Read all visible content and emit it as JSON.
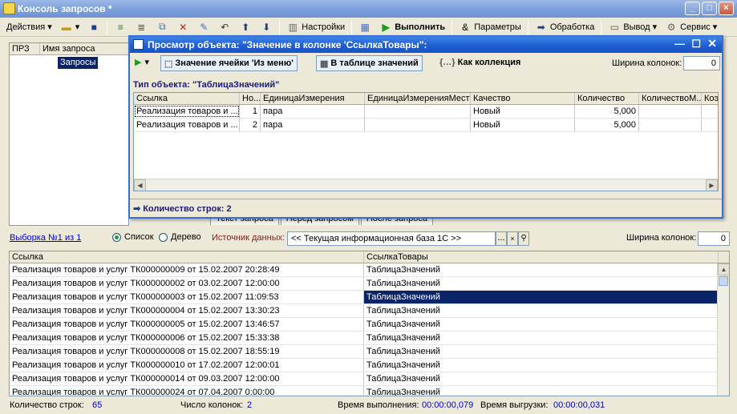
{
  "window": {
    "title": "Консоль запросов *"
  },
  "toolbar": {
    "actions_label": "Действия",
    "settings_label": "Настройки",
    "run_label": "Выполнить",
    "params_label": "Параметры",
    "processing_label": "Обработка",
    "output_label": "Вывод",
    "service_label": "Сервис"
  },
  "left": {
    "col_prz": "ПРЗ",
    "col_name": "Имя запроса",
    "item": "Запросы"
  },
  "tabs": [
    "Текст запроса",
    "Перед запросом",
    "После запроса"
  ],
  "selection": {
    "label": "Выборка №1 из 1",
    "list_label": "Список",
    "tree_label": "Дерево",
    "source_label": "Источник данных:",
    "source_value": "<< Текущая информационная база 1С >>",
    "colwidth_label": "Ширина колонок:",
    "colwidth_value": "0"
  },
  "main_table": {
    "col1": "Ссылка",
    "col2": "СсылкаТовары",
    "rows": [
      [
        "Реализация товаров и услуг ТК000000009 от 15.02.2007 20:28:49",
        "ТаблицаЗначений"
      ],
      [
        "Реализация товаров и услуг ТК000000002 от 03.02.2007 12:00:00",
        "ТаблицаЗначений"
      ],
      [
        "Реализация товаров и услуг ТК000000003 от 15.02.2007 11:09:53",
        "ТаблицаЗначений"
      ],
      [
        "Реализация товаров и услуг ТК000000004 от 15.02.2007 13:30:23",
        "ТаблицаЗначений"
      ],
      [
        "Реализация товаров и услуг ТК000000005 от 15.02.2007 13:46:57",
        "ТаблицаЗначений"
      ],
      [
        "Реализация товаров и услуг ТК000000006 от 15.02.2007 15:33:38",
        "ТаблицаЗначений"
      ],
      [
        "Реализация товаров и услуг ТК000000008 от 15.02.2007 18:55:19",
        "ТаблицаЗначений"
      ],
      [
        "Реализация товаров и услуг ТК000000010 от 17.02.2007 12:00:01",
        "ТаблицаЗначений"
      ],
      [
        "Реализация товаров и услуг ТК000000014 от 09.03.2007 12:00:00",
        "ТаблицаЗначений"
      ],
      [
        "Реализация товаров и услуг ТК000000024 от 07.04.2007 0:00:00",
        "ТаблицаЗначений"
      ]
    ]
  },
  "status": {
    "rows_label": "Количество строк:",
    "rows_value": "65",
    "cols_label": "Число колонок:",
    "cols_value": "2",
    "exec_label": "Время выполнения:",
    "exec_value": "00:00:00,079",
    "export_label": "Время выгрузки:",
    "export_value": "00:00:00,031"
  },
  "modal": {
    "title": "Просмотр объекта: \"Значение в колонке 'СсылкаТовары\":",
    "btn_cell": "Значение ячейки 'Из меню'",
    "btn_table": "В таблице значений",
    "btn_collection": "Как коллекция",
    "colwidth_label": "Ширина колонок:",
    "colwidth_value": "0",
    "type_label": "Тип объекта: \"ТаблицаЗначений\"",
    "columns": [
      "Ссылка",
      "Но...",
      "ЕдиницаИзмерения",
      "ЕдиницаИзмеренияМест",
      "Качество",
      "Количество",
      "КоличествоМ...",
      "Коэ"
    ],
    "rows": [
      [
        "Реализация товаров и ...",
        "1",
        "пара",
        "",
        "Новый",
        "5,000",
        "",
        ""
      ],
      [
        "Реализация товаров и ...",
        "2",
        "пара",
        "",
        "Новый",
        "5,000",
        "",
        ""
      ]
    ],
    "footer": "Количество строк: 2"
  }
}
